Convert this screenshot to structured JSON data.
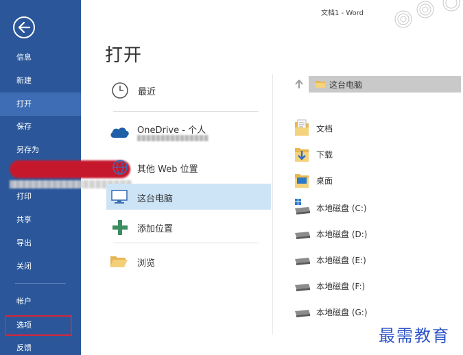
{
  "window": {
    "title": "文档1 - Word"
  },
  "sidebar": {
    "items": [
      {
        "label": "信息"
      },
      {
        "label": "新建"
      },
      {
        "label": "打开"
      },
      {
        "label": "保存"
      },
      {
        "label": "另存为"
      },
      {
        "label": "打印"
      },
      {
        "label": "共享"
      },
      {
        "label": "导出"
      },
      {
        "label": "关闭"
      },
      {
        "label": "帐户"
      },
      {
        "label": "选项"
      },
      {
        "label": "反馈"
      }
    ],
    "active": "打开",
    "highlighted": "选项"
  },
  "main": {
    "title": "打开",
    "locations": [
      {
        "label": "最近"
      },
      {
        "label": "OneDrive - 个人"
      },
      {
        "label": "其他 Web 位置"
      },
      {
        "label": "这台电脑"
      },
      {
        "label": "添加位置"
      },
      {
        "label": "浏览"
      }
    ],
    "selected_location": "这台电脑"
  },
  "browser": {
    "path": "这台电脑",
    "folders": [
      {
        "label": "文档"
      },
      {
        "label": "下载"
      },
      {
        "label": "桌面"
      },
      {
        "label": "本地磁盘 (C:)"
      },
      {
        "label": "本地磁盘 (D:)"
      },
      {
        "label": "本地磁盘 (E:)"
      },
      {
        "label": "本地磁盘 (F:)"
      },
      {
        "label": "本地磁盘 (G:)"
      }
    ]
  },
  "watermark": {
    "text": "最需教育"
  },
  "colors": {
    "sidebar": "#2b579a",
    "sidebar_active": "#3e6db5",
    "selected": "#cde4f7",
    "highlight_box": "#d4263a"
  }
}
